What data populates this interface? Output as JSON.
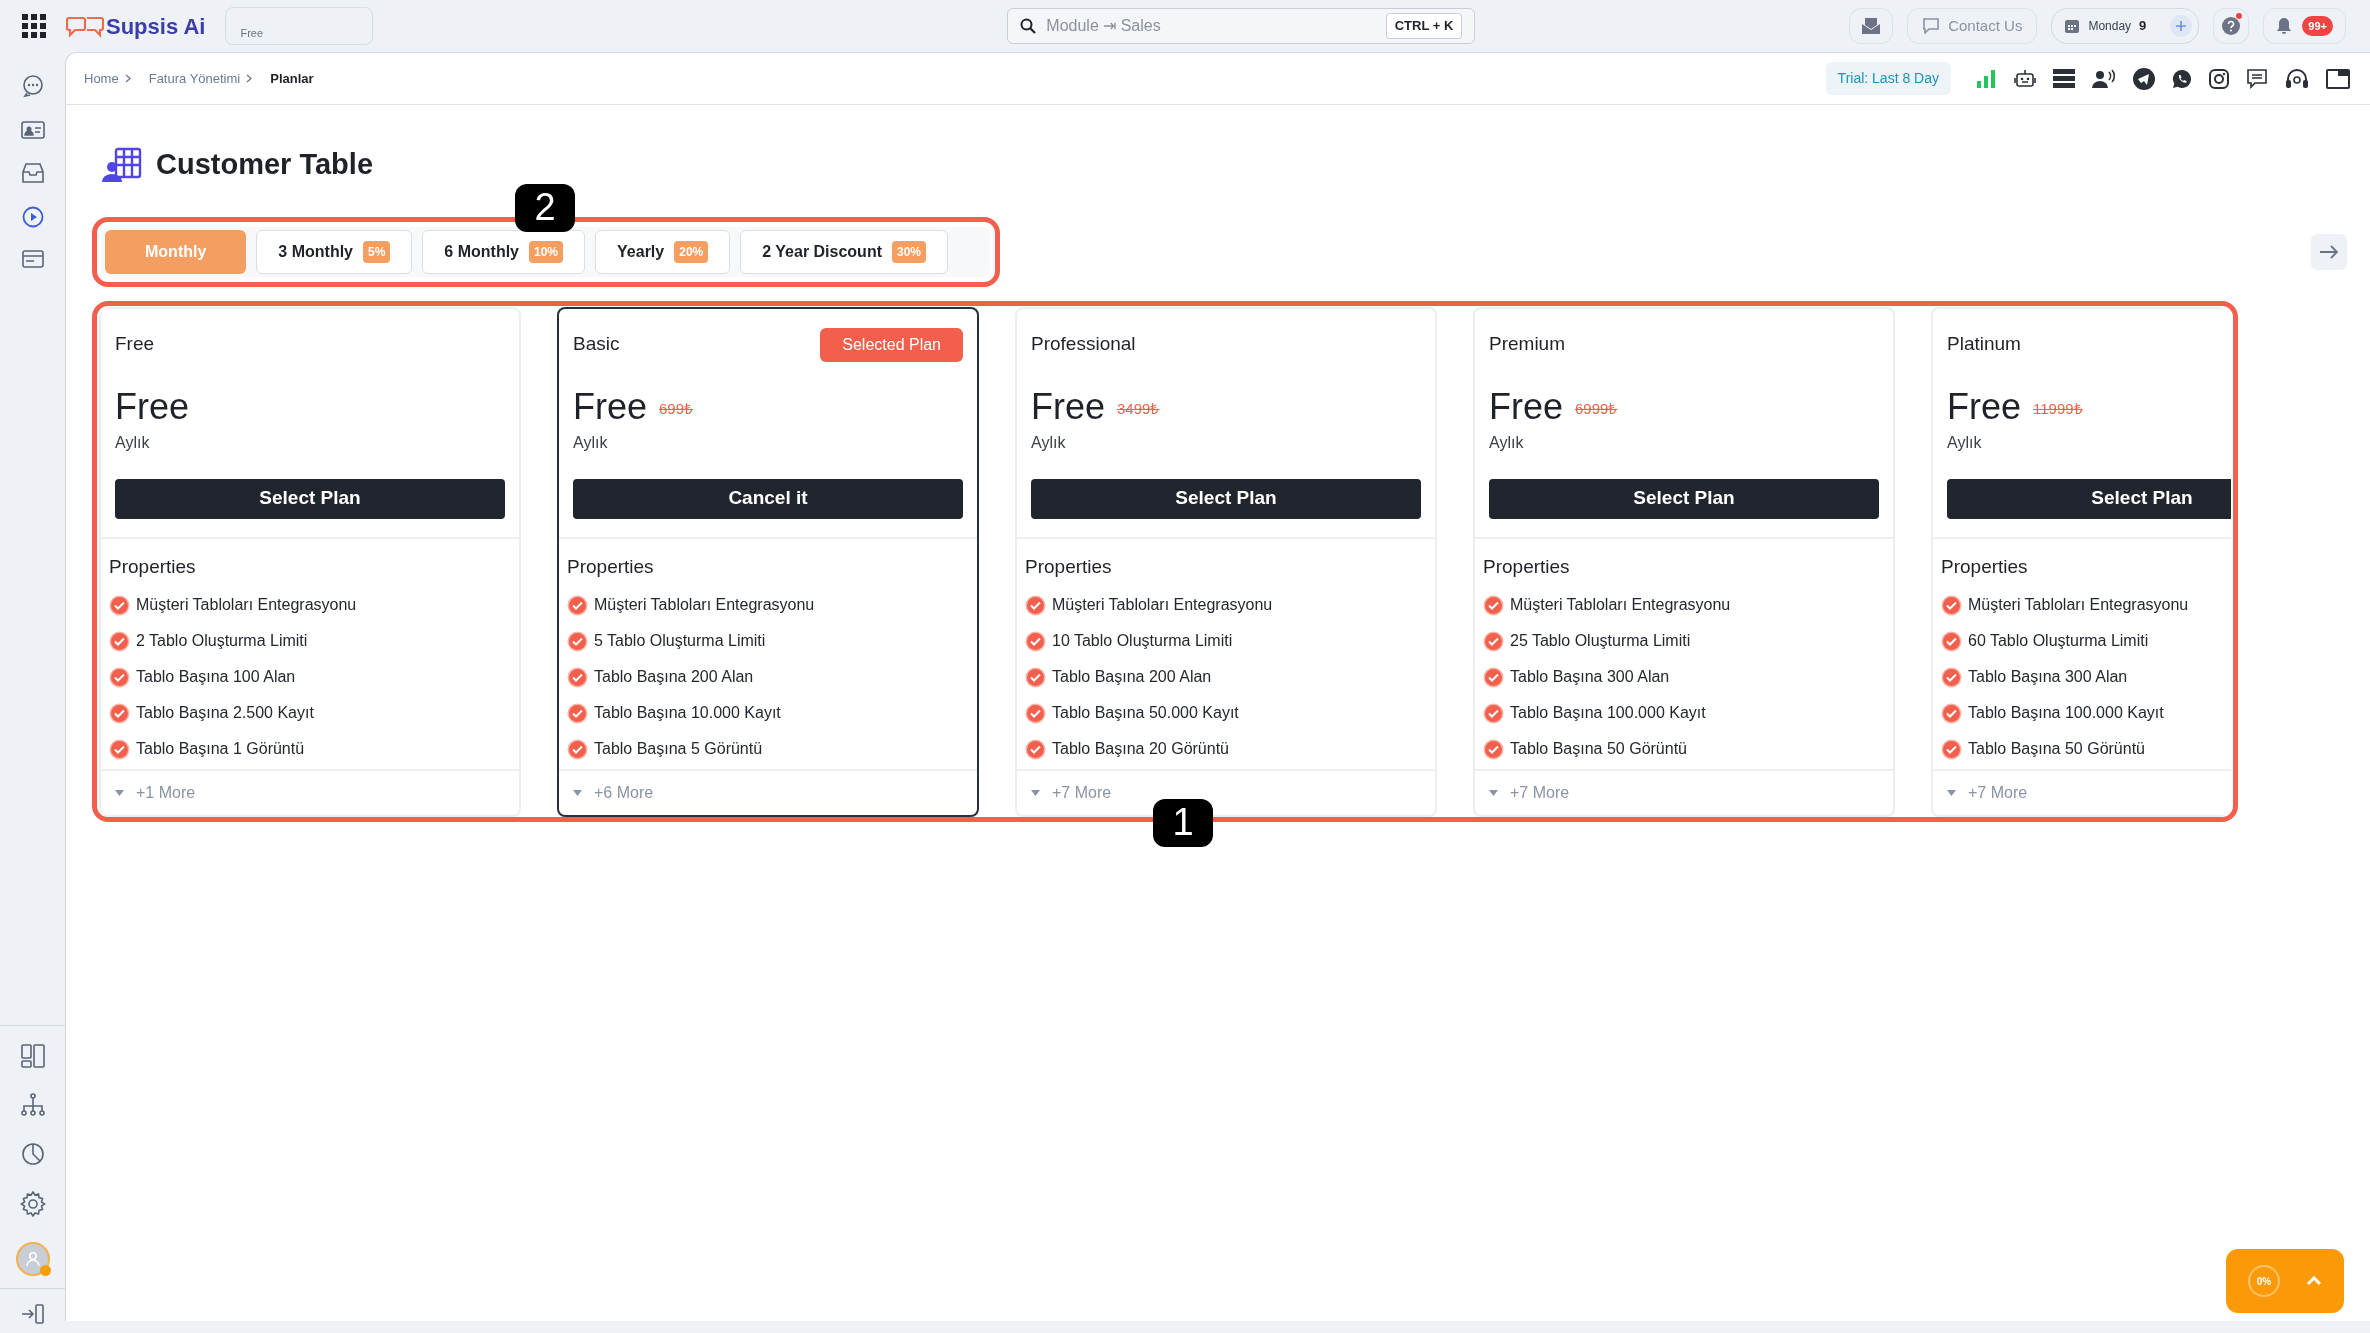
{
  "app": {
    "brand": "Supsis Ai",
    "workspace": "Free"
  },
  "search": {
    "placeholder": "Module ⇥ Sales",
    "shortcut": "CTRL + K"
  },
  "header_actions": {
    "contact": "Contact Us",
    "day": "Monday",
    "date": "9",
    "notifications": "99+"
  },
  "breadcrumb": [
    {
      "label": "Home",
      "current": false
    },
    {
      "label": "Fatura Yönetimi",
      "current": false
    },
    {
      "label": "Planlar",
      "current": true
    }
  ],
  "trial": "Trial: Last 8 Day",
  "page_title": "Customer Table",
  "period_tabs": [
    {
      "label": "Monthly",
      "selected": true
    },
    {
      "label": "3 Monthly",
      "discount": "5%",
      "selected": false
    },
    {
      "label": "6 Monthly",
      "discount": "10%",
      "selected": false
    },
    {
      "label": "Yearly",
      "discount": "20%",
      "selected": false
    },
    {
      "label": "2 Year Discount",
      "discount": "30%",
      "selected": false
    }
  ],
  "plans": [
    {
      "name": "Free",
      "price": "Free",
      "period": "Aylık",
      "button": "Select Plan",
      "selected": false,
      "properties_title": "Properties",
      "features": [
        "Müşteri Tabloları Entegrasyonu",
        "2 Tablo Oluşturma Limiti",
        "Tablo Başına 100 Alan",
        "Tablo Başına 2.500 Kayıt",
        "Tablo Başına 1 Görüntü"
      ],
      "more": "+1 More"
    },
    {
      "name": "Basic",
      "badge": "Selected Plan",
      "price": "Free",
      "old_price": "699₺",
      "period": "Aylık",
      "button": "Cancel it",
      "selected": true,
      "properties_title": "Properties",
      "features": [
        "Müşteri Tabloları Entegrasyonu",
        "5 Tablo Oluşturma Limiti",
        "Tablo Başına 200 Alan",
        "Tablo Başına 10.000 Kayıt",
        "Tablo Başına 5 Görüntü"
      ],
      "more": "+6 More"
    },
    {
      "name": "Professional",
      "price": "Free",
      "old_price": "3499₺",
      "period": "Aylık",
      "button": "Select Plan",
      "selected": false,
      "properties_title": "Properties",
      "features": [
        "Müşteri Tabloları Entegrasyonu",
        "10 Tablo Oluşturma Limiti",
        "Tablo Başına 200 Alan",
        "Tablo Başına 50.000 Kayıt",
        "Tablo Başına 20 Görüntü"
      ],
      "more": "+7 More"
    },
    {
      "name": "Premium",
      "price": "Free",
      "old_price": "6999₺",
      "period": "Aylık",
      "button": "Select Plan",
      "selected": false,
      "properties_title": "Properties",
      "features": [
        "Müşteri Tabloları Entegrasyonu",
        "25 Tablo Oluşturma Limiti",
        "Tablo Başına 300 Alan",
        "Tablo Başına 100.000 Kayıt",
        "Tablo Başına 50 Görüntü"
      ],
      "more": "+7 More"
    },
    {
      "name": "Platinum",
      "price": "Free",
      "old_price": "11999₺",
      "period": "Aylık",
      "button": "Select Plan",
      "selected": false,
      "properties_title": "Properties",
      "features": [
        "Müşteri Tabloları Entegrasyonu",
        "60 Tablo Oluşturma Limiti",
        "Tablo Başına 300 Alan",
        "Tablo Başına 100.000 Kayıt",
        "Tablo Başına 50 Görüntü"
      ],
      "more": "+7 More"
    }
  ],
  "annotations": [
    {
      "label": "2"
    },
    {
      "label": "1"
    }
  ],
  "progress_widget": {
    "percent": "0%"
  }
}
